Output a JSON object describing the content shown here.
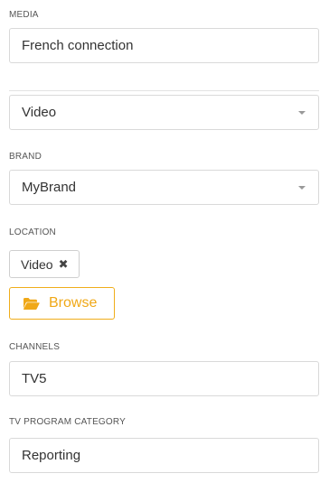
{
  "media": {
    "label": "MEDIA",
    "value": "French connection"
  },
  "media_type": {
    "selected": "Video"
  },
  "brand": {
    "label": "BRAND",
    "selected": "MyBrand"
  },
  "location": {
    "label": "LOCATION",
    "tag": "Video",
    "browse_label": "Browse"
  },
  "channels": {
    "label": "CHANNELS",
    "value": "TV5"
  },
  "tv_program_category": {
    "label": "TV PROGRAM CATEGORY",
    "value": "Reporting"
  },
  "colors": {
    "accent": "#f0a817",
    "border": "#d9d9d9",
    "label": "#555555"
  },
  "icons": {
    "tag_remove": "close-icon",
    "browse": "folder-open-icon",
    "select_caret": "caret-down-icon"
  }
}
